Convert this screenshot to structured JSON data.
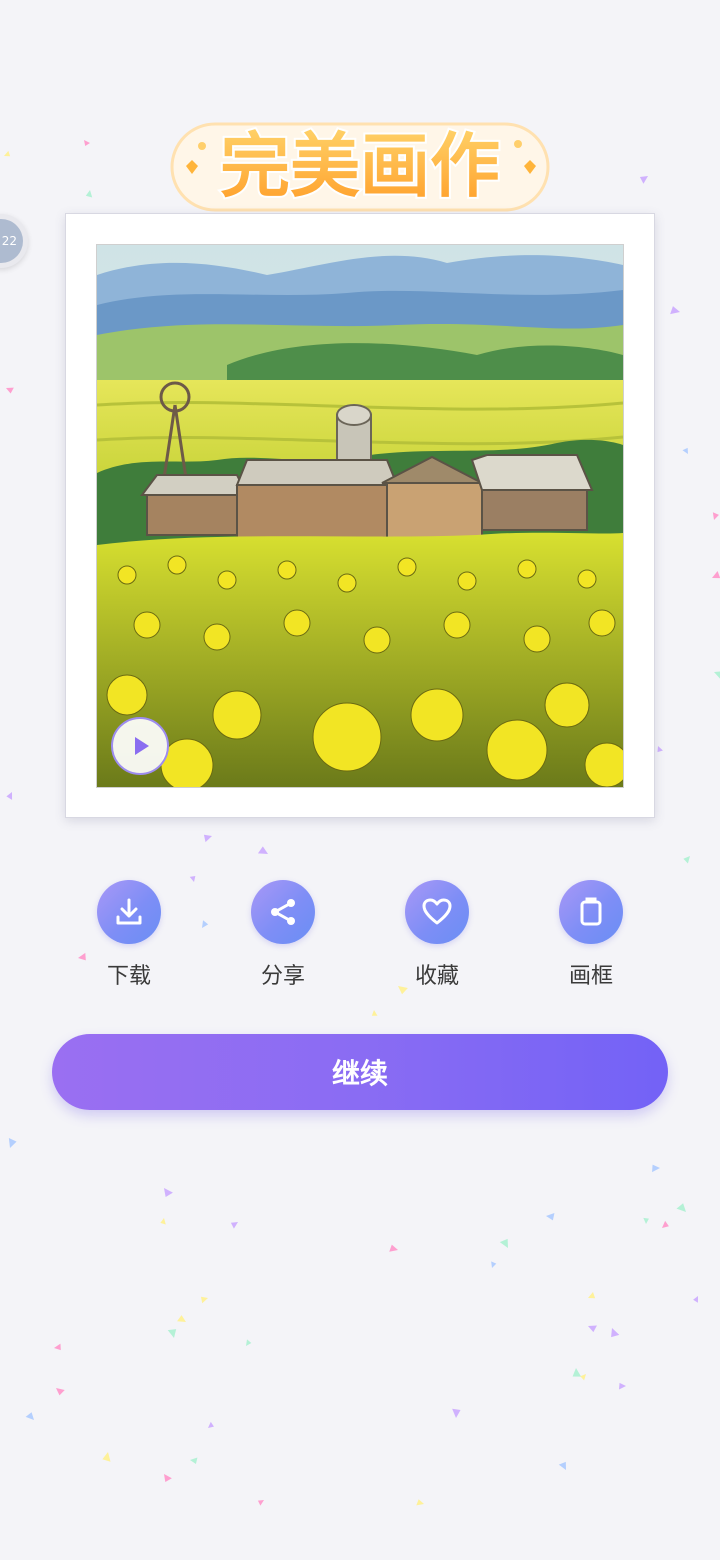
{
  "colors": {
    "background": "#f4f4f8",
    "accent_start": "#9a6ff2",
    "accent_end": "#7362f6",
    "title_fill": "#ffb43a",
    "title_outline": "#ffffff"
  },
  "header": {
    "title": "完美画作"
  },
  "side_badge": {
    "text": "22"
  },
  "artwork": {
    "subject": "dandelion-field-farm-illustration",
    "play_icon": "play-icon"
  },
  "actions": [
    {
      "id": "download",
      "label": "下载",
      "icon": "download-icon"
    },
    {
      "id": "share",
      "label": "分享",
      "icon": "share-icon"
    },
    {
      "id": "favorite",
      "label": "收藏",
      "icon": "heart-icon"
    },
    {
      "id": "frame",
      "label": "画框",
      "icon": "frame-icon"
    }
  ],
  "continue_button": {
    "label": "继续"
  }
}
